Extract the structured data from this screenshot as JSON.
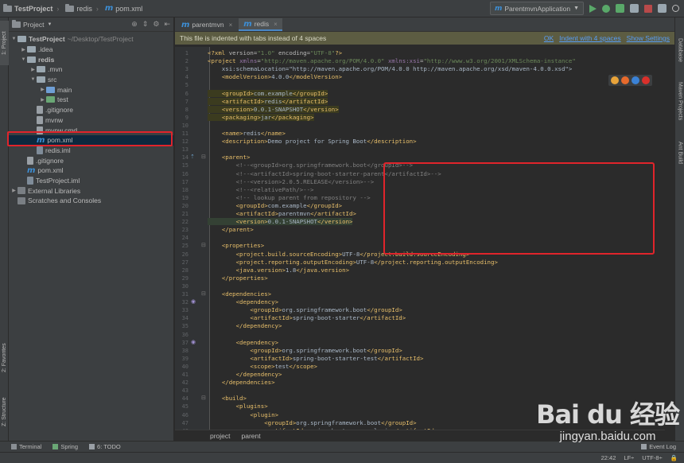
{
  "breadcrumbs": [
    "TestProject",
    "redis",
    "pom.xml"
  ],
  "run_config": "ParentmvnApplication",
  "left_tabs": [
    "1: Project",
    "2: Favorites",
    "Z: Structure"
  ],
  "right_tabs": [
    "Database",
    "Maven Projects",
    "Ant Build"
  ],
  "project_panel": {
    "title": "Project",
    "tree": [
      {
        "label": "TestProject",
        "path": "~/Desktop/TestProject",
        "icon": "folder",
        "depth": 0,
        "arrow": "down",
        "bold": true
      },
      {
        "label": ".idea",
        "icon": "folder",
        "depth": 1,
        "arrow": "right"
      },
      {
        "label": "redis",
        "icon": "folder",
        "depth": 1,
        "arrow": "down",
        "bold": true
      },
      {
        "label": ".mvn",
        "icon": "folder",
        "depth": 2,
        "arrow": "right"
      },
      {
        "label": "src",
        "icon": "folder",
        "depth": 2,
        "arrow": "down"
      },
      {
        "label": "main",
        "icon": "folder",
        "depth": 3,
        "arrow": "right"
      },
      {
        "label": "test",
        "icon": "folder",
        "depth": 3,
        "arrow": "right"
      },
      {
        "label": ".gitignore",
        "icon": "file",
        "depth": 2
      },
      {
        "label": "mvnw",
        "icon": "file",
        "depth": 2
      },
      {
        "label": "mvnw.cmd",
        "icon": "file",
        "depth": 2
      },
      {
        "label": "pom.xml",
        "icon": "maven",
        "depth": 2,
        "selected": true
      },
      {
        "label": "redis.iml",
        "icon": "iml",
        "depth": 2
      },
      {
        "label": ".gitignore",
        "icon": "file",
        "depth": 1
      },
      {
        "label": "pom.xml",
        "icon": "maven",
        "depth": 1
      },
      {
        "label": "TestProject.iml",
        "icon": "iml",
        "depth": 1
      },
      {
        "label": "External Libraries",
        "icon": "lib",
        "depth": 0,
        "arrow": "right"
      },
      {
        "label": "Scratches and Consoles",
        "icon": "lib",
        "depth": 0
      }
    ]
  },
  "editor_tabs": [
    {
      "label": "parentmvn",
      "active": false
    },
    {
      "label": "redis",
      "active": true
    }
  ],
  "notice": {
    "text": "This file is indented with tabs instead of 4 spaces",
    "actions": [
      "OK",
      "Indent with 4 spaces",
      "Show Settings"
    ]
  },
  "code_lines": [
    "<?xml version=\"1.0\" encoding=\"UTF-8\"?>",
    "<project xmlns=\"http://maven.apache.org/POM/4.0.0\" xmlns:xsi=\"http://www.w3.org/2001/XMLSchema-instance\"",
    "\txsi:schemaLocation=\"http://maven.apache.org/POM/4.0.0 http://maven.apache.org/xsd/maven-4.0.0.xsd\">",
    "\t<modelVersion>4.0.0</modelVersion>",
    "",
    "\t<groupId>com.example</groupId>",
    "\t<artifactId>redis</artifactId>",
    "\t<version>0.0.1-SNAPSHOT</version>",
    "\t<packaging>jar</packaging>",
    "",
    "\t<name>redis</name>",
    "\t<description>Demo project for Spring Boot</description>",
    "",
    "\t<parent>",
    "\t\t<!--<groupId>org.springframework.boot</groupId>-->",
    "\t\t<!--<artifactId>spring-boot-starter-parent</artifactId>-->",
    "\t\t<!--<version>2.0.5.RELEASE</version>-->",
    "\t\t<!--<relativePath/>-->",
    "\t\t<!-- lookup parent from repository -->",
    "\t\t<groupId>com.example</groupId>",
    "\t\t<artifactId>parentmvn</artifactId>",
    "\t\t<version>0.0.1-SNAPSHOT</version>",
    "\t</parent>",
    "",
    "\t<properties>",
    "\t\t<project.build.sourceEncoding>UTF-8</project.build.sourceEncoding>",
    "\t\t<project.reporting.outputEncoding>UTF-8</project.reporting.outputEncoding>",
    "\t\t<java.version>1.8</java.version>",
    "\t</properties>",
    "",
    "\t<dependencies>",
    "\t\t<dependency>",
    "\t\t\t<groupId>org.springframework.boot</groupId>",
    "\t\t\t<artifactId>spring-boot-starter</artifactId>",
    "\t\t</dependency>",
    "",
    "\t\t<dependency>",
    "\t\t\t<groupId>org.springframework.boot</groupId>",
    "\t\t\t<artifactId>spring-boot-starter-test</artifactId>",
    "\t\t\t<scope>test</scope>",
    "\t\t</dependency>",
    "\t</dependencies>",
    "",
    "\t<build>",
    "\t\t<plugins>",
    "\t\t\t<plugin>",
    "\t\t\t\t<groupId>org.springframework.boot</groupId>",
    "\t\t\t\t<artifactId>spring-boot-maven-plugin</artifactId>"
  ],
  "editor_breadcrumbs": [
    "project",
    "parent"
  ],
  "bottom_tools": [
    "Terminal",
    "Spring",
    "6: TODO"
  ],
  "event_log": "Event Log",
  "status": {
    "position": "22:42",
    "line_sep": "LF÷",
    "encoding": "UTF-8÷"
  },
  "watermark": {
    "logo": "Bai du 经验",
    "url": "jingyan.baidu.com"
  },
  "colors": {
    "highlight_box": "#e0242b",
    "accent": "#4a88c7"
  }
}
